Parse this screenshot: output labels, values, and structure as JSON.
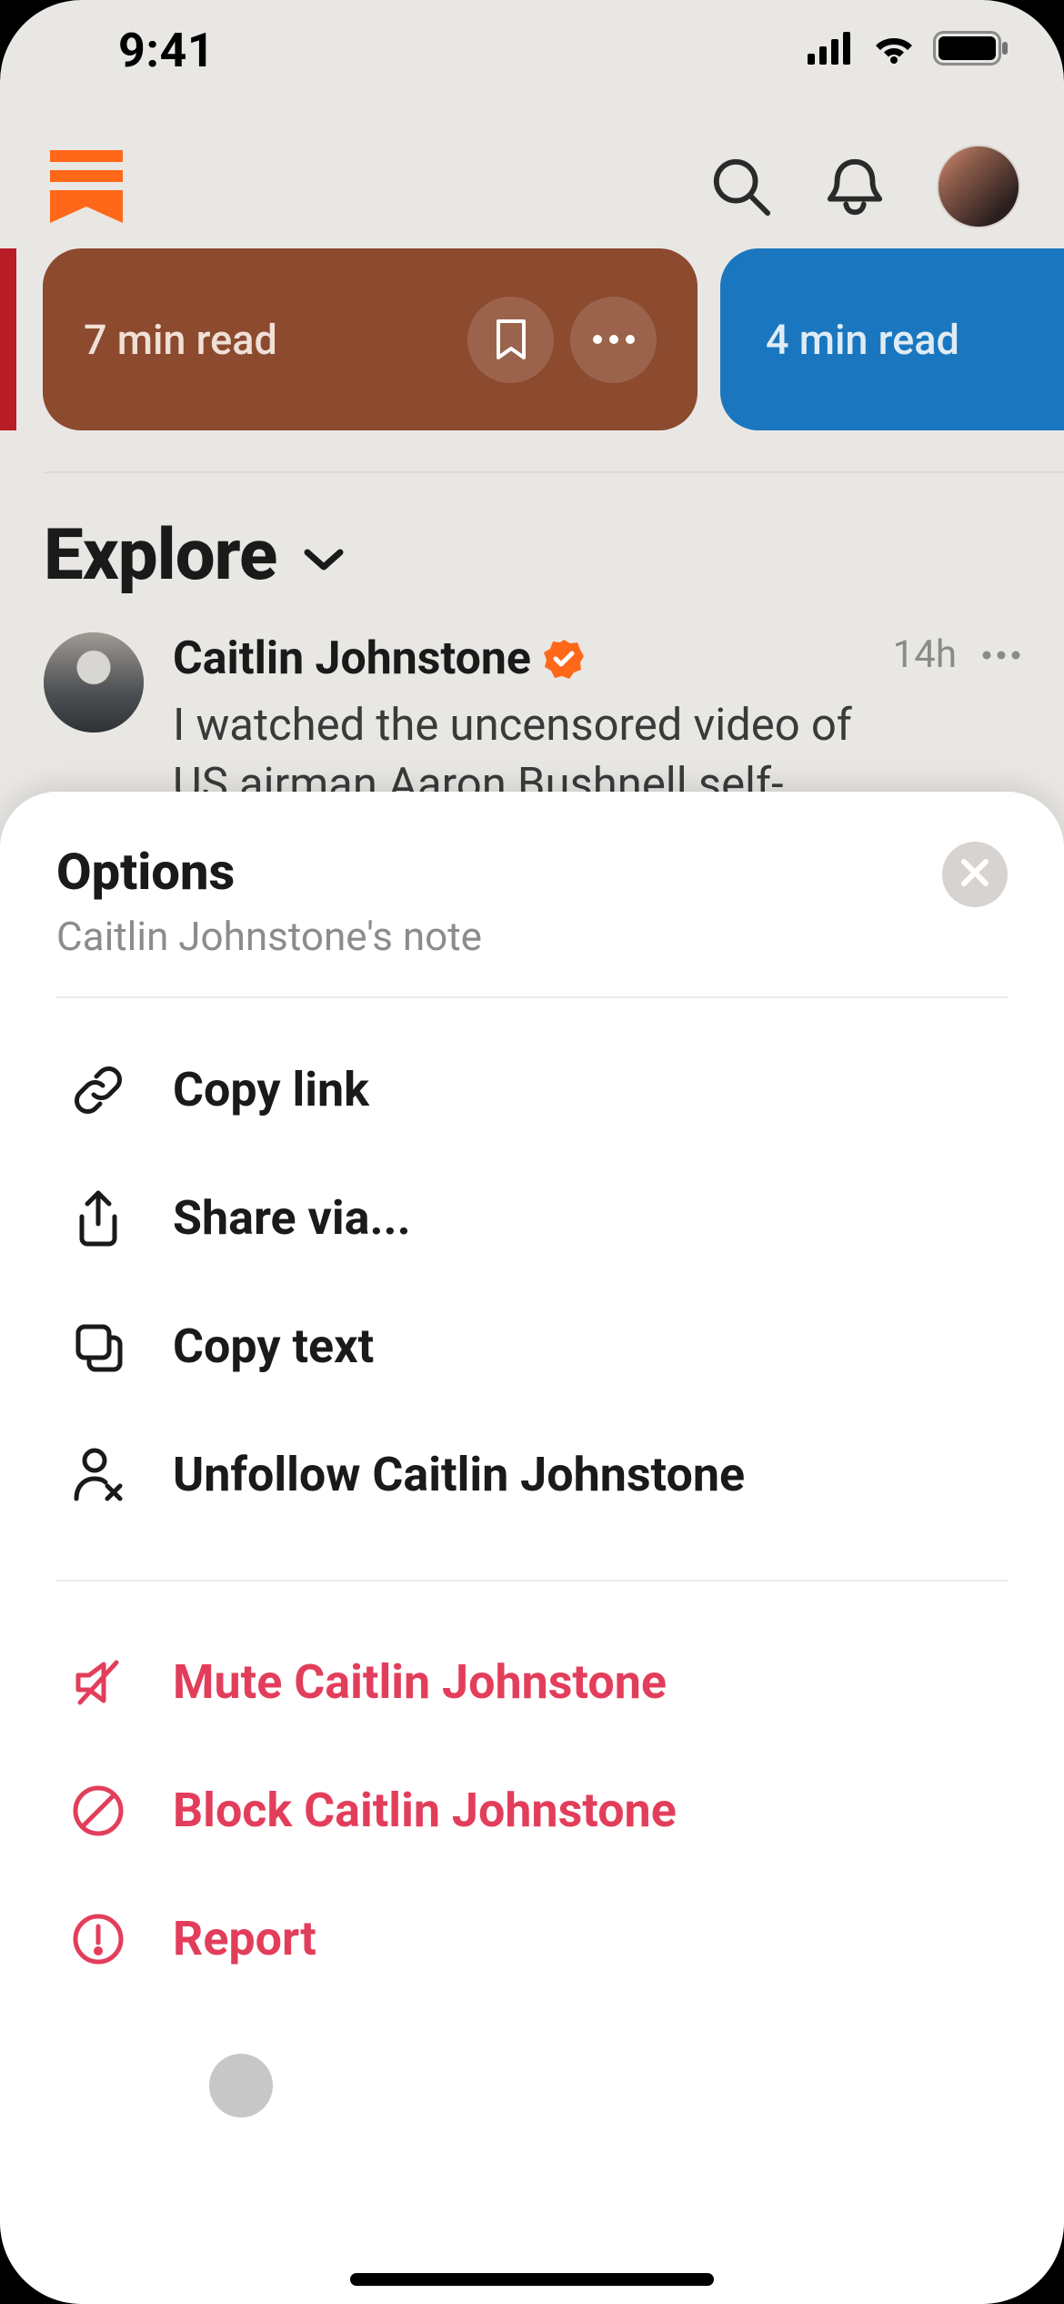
{
  "status": {
    "time": "9:41"
  },
  "cards": {
    "brown": {
      "read_time": "7 min read"
    },
    "blue": {
      "read_time": "4 min read"
    }
  },
  "explore": {
    "title": "Explore"
  },
  "post": {
    "author": "Caitlin Johnstone",
    "time": "14h",
    "body": "I watched the uncensored video of US airman Aaron Bushnell self-immolating in"
  },
  "sheet": {
    "title": "Options",
    "subtitle": "Caitlin Johnstone's note",
    "options": {
      "copy_link": "Copy link",
      "share_via": "Share via...",
      "copy_text": "Copy text",
      "unfollow": "Unfollow Caitlin Johnstone",
      "mute": "Mute Caitlin Johnstone",
      "block": "Block Caitlin Johnstone",
      "report": "Report"
    }
  }
}
